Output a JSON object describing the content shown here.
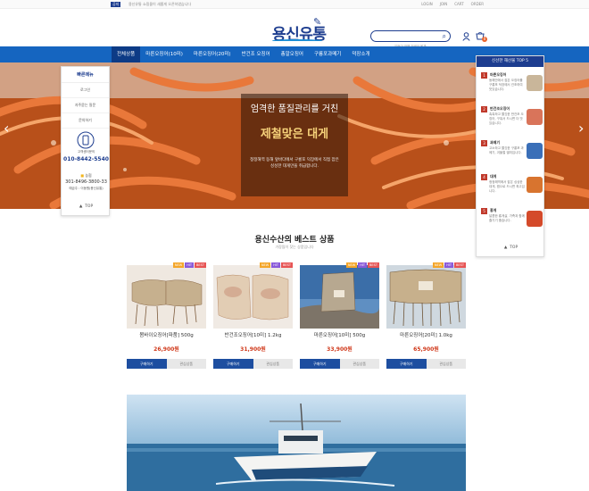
{
  "topbar": {
    "badge": "공지",
    "notice": "용신유통 쇼핑몰이 새롭게 오픈하였습니다",
    "links": [
      "LOGIN",
      "JOIN",
      "CART",
      "ORDER"
    ]
  },
  "header": {
    "logo_text": "용신유통",
    "search_placeholder": "",
    "search_hint": "무엇이 대해 검색이 될까",
    "cart_count": "0"
  },
  "nav": {
    "items": [
      "전체상품",
      "마른오징어(10미)",
      "마른오징어(20미)",
      "반건조 오징어",
      "총알오징어",
      "구룡포과메기",
      "덕장소개"
    ]
  },
  "hero": {
    "title": "엄격한 품질관리를 거친",
    "highlight": "제철맞은 대게",
    "desc": "청정해역 동해 앞바다에서 구룡포 덕장에서 직접 잡은 싱싱한 대게만을 취급합니다."
  },
  "left_sidebar": {
    "title": "빠른메뉴",
    "items": [
      "로그인",
      "자주묻는 질문",
      "문의하기"
    ],
    "call_label": "고객센터문의",
    "phone": "010-8442-5540",
    "bank": "농협",
    "account": "301-8496-3800-33",
    "holder": "예금주 : 이동원(용신유통)",
    "top": "TOP"
  },
  "right_sidebar": {
    "title": "신선한 해산물 TOP 5",
    "items": [
      {
        "num": "1",
        "name": "마른오징어",
        "desc": "동해안에서 잡은 오징어를 구룡포 덕장에서 건조하여 맛있습니다.",
        "color": "#c9b69a"
      },
      {
        "num": "2",
        "name": "반건조오징어",
        "desc": "촉촉하고 쫄깃한 반건조 오징어, 구워서 드시면 더 맛있습니다.",
        "color": "#d9745a"
      },
      {
        "num": "3",
        "name": "과메기",
        "desc": "고소하고 쫄깃한 구룡포 과메기, 겨울철 별미입니다.",
        "color": "#3a6fb8"
      },
      {
        "num": "4",
        "name": "대게",
        "desc": "청정해역에서 잡은 싱싱한 대게, 찜으로 드시면 최고입니다.",
        "color": "#d8742f"
      },
      {
        "num": "5",
        "name": "홍게",
        "desc": "달콤한 홍게살, 가족과 함께 즐기기 좋습니다.",
        "color": "#d44a2a"
      }
    ],
    "top": "TOP"
  },
  "section": {
    "title": "용신수산의 베스트 상품",
    "subtitle": "가장많이 찾는 상품입니다"
  },
  "products": [
    {
      "name": "몸바이오징어[파품] 500g",
      "price": "26,900원",
      "buy": "구매하기",
      "more": "관심상품",
      "tags": [
        "NEW",
        "HIT",
        "BEST"
      ]
    },
    {
      "name": "반건조오징어[10미] 1.2kg",
      "price": "31,900원",
      "buy": "구매하기",
      "more": "관심상품",
      "tags": [
        "NEW",
        "HIT",
        "BEST"
      ]
    },
    {
      "name": "마른오징어[10미] 500g",
      "price": "33,900원",
      "buy": "구매하기",
      "more": "관심상품",
      "tags": [
        "NEW",
        "HIT",
        "BEST"
      ]
    },
    {
      "name": "마른오징어[20미] 1.0kg",
      "price": "65,900원",
      "buy": "구매하기",
      "more": "관심상품",
      "tags": [
        "NEW",
        "HIT",
        "BEST"
      ]
    }
  ],
  "colors": {
    "brand": "#1d3d8f",
    "nav": "#1565c0",
    "price": "#d0391b",
    "hero_text": "#f6d27a"
  },
  "icons": [
    "search-icon",
    "user-icon",
    "cart-icon",
    "phone-icon",
    "chevron-left-icon",
    "chevron-right-icon"
  ]
}
